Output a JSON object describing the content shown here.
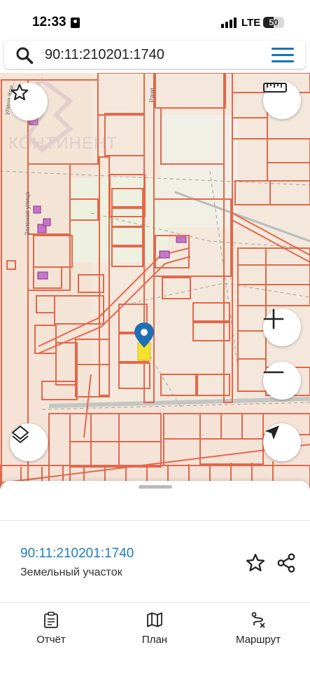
{
  "status_bar": {
    "time": "12:33",
    "network": "LTE",
    "battery": "50",
    "battery_level": 0.5
  },
  "search": {
    "value": "90:11:210201:1740",
    "icon": "search-icon",
    "menu_icon": "hamburger-menu-icon"
  },
  "map": {
    "watermark": "КОНТИНЕНТ",
    "street_label_1": "Зеленая улица",
    "street_label_2": "Рани...",
    "street_label_3": "улица Кри...",
    "colors": {
      "background": "#f4e8dc",
      "parcel_line": "#e4674a",
      "selected_parcel": "#f5e02e",
      "pin": "#1f6fb4"
    },
    "buttons": {
      "favorite": "star-icon",
      "ruler": "ruler-icon",
      "zoom_in": "plus-icon",
      "zoom_out": "minus-icon",
      "layers": "layers-icon",
      "locate": "navigation-arrow-icon"
    }
  },
  "sheet": {
    "parcel_number": "90:11:210201:1740",
    "parcel_type": "Земельный участок"
  },
  "nav": {
    "report": "Отчёт",
    "plan": "План",
    "route": "Маршрут"
  }
}
